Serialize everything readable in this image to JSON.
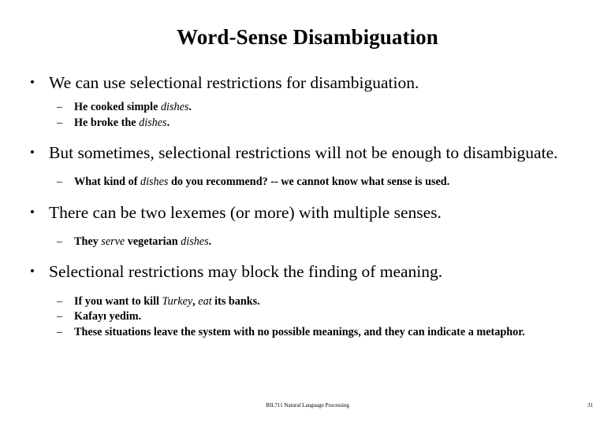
{
  "slide": {
    "title": "Word-Sense Disambiguation",
    "bullets": [
      {
        "text": "We can use selectional restrictions for disambiguation.",
        "sub": [
          {
            "pre": "He cooked simple ",
            "italic": "dishes",
            "post": "."
          },
          {
            "pre": "He broke the ",
            "italic": "dishes",
            "post": "."
          }
        ]
      },
      {
        "text": "But sometimes, selectional restrictions will not be enough to disambiguate.",
        "sub": [
          {
            "pre": "What kind of ",
            "italic": "dishes",
            "post": " do you recommend? -- we cannot know what sense is used."
          }
        ]
      },
      {
        "text": "There can be two lexemes (or more) with multiple senses.",
        "sub": [
          {
            "pre": "They ",
            "italic": "serve",
            "mid": " vegetarian ",
            "italic2": "dishes",
            "post": "."
          }
        ]
      },
      {
        "text": "Selectional restrictions may block the finding of meaning.",
        "sub": [
          {
            "pre": "If you want to kill ",
            "italic": "Turkey",
            "mid": ", ",
            "italic2": "eat",
            "post": " its banks."
          },
          {
            "pre": "Kafayı yedim.",
            "italic": "",
            "post": ""
          },
          {
            "pre": "These situations leave the system with no possible meanings, and they can indicate a metaphor.",
            "italic": "",
            "post": ""
          }
        ]
      }
    ],
    "markers": {
      "level1": "•",
      "level2": "–"
    },
    "footer": {
      "course": "BIL711 Natural Language Processing",
      "page_number": "31"
    },
    "colors": {
      "background": "#ffffff",
      "text": "#000000"
    }
  }
}
